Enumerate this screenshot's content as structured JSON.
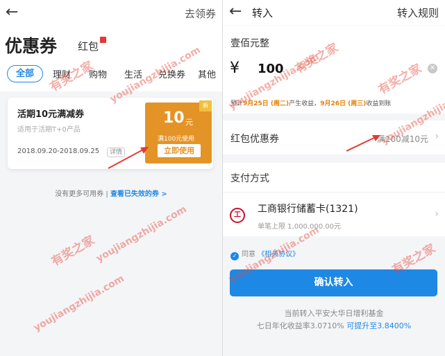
{
  "left": {
    "header_link": "去领券",
    "title": "优惠券",
    "hongbao_tab": "红包",
    "tabs": [
      "全部",
      "理财",
      "购物",
      "生活",
      "兑换券",
      "其他"
    ],
    "coupon": {
      "title": "活期10元满减券",
      "subtitle": "适用于活期T+0产品",
      "date_range": "2018.09.20-2018.09.25",
      "detail": "详情",
      "new_badge": "新",
      "amount": "10",
      "unit": "元",
      "condition": "满100元使用",
      "use_button": "立即使用"
    },
    "footer_gray": "没有更多可用券 |",
    "footer_link": "查看已失效的券 >"
  },
  "right": {
    "back_title": "转入",
    "rules": "转入规则",
    "amount_words": "壹佰元整",
    "currency": "¥",
    "amount": "100",
    "note_prefix": "预计",
    "note_date1": "9月25日 (周二)",
    "note_mid": "产生收益，",
    "note_date2": "9月26日 (周三)",
    "note_suffix": "收益到账",
    "coupon_label": "红包优惠券",
    "coupon_value": "满100减10元",
    "payment_label": "支付方式",
    "bank_name": "工商银行储蓄卡(1321)",
    "bank_limit": "单笔上限 1,000,000.00元",
    "agree_text": "同意",
    "agree_link": "《相关协议》",
    "confirm_button": "确认转入",
    "footer_line1": "当前转入平安大华日增利基金",
    "footer_line2_prefix": "七日年化收益率3.0710%",
    "footer_line2_link": "可提升至3.8400%"
  },
  "watermark": {
    "cn": "有奖之家",
    "en": "youjiangzhijia.com"
  },
  "colors": {
    "accent_blue": "#1e88e5",
    "coupon_orange": "#e49326",
    "arrow_red": "#e53935"
  }
}
